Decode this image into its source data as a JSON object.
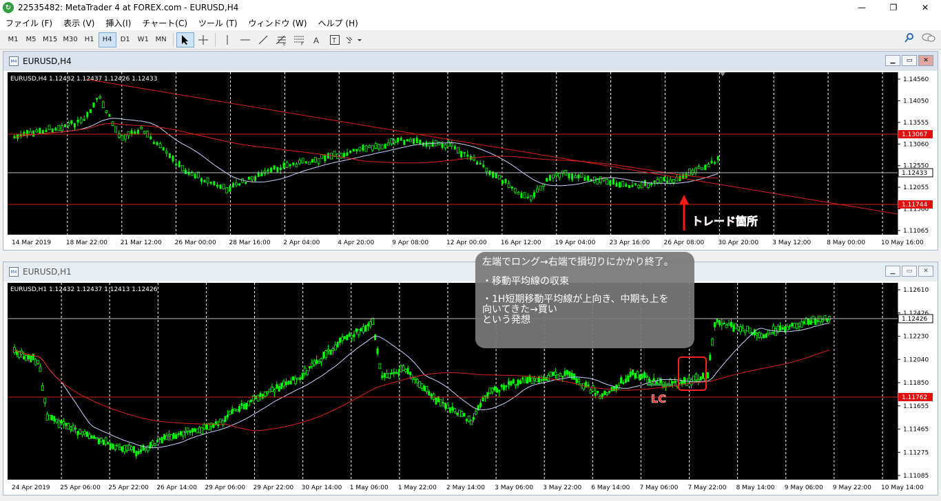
{
  "window": {
    "title": "22535482: MetaTrader 4 at FOREX.com - EURUSD,H4",
    "app_icon": "metatrader-icon",
    "buttons": {
      "min": "—",
      "max": "❐",
      "close": "✕"
    }
  },
  "menu": [
    "ファイル (F)",
    "表示 (V)",
    "挿入(I)",
    "チャート(C)",
    "ツール (T)",
    "ウィンドウ (W)",
    "ヘルプ (H)"
  ],
  "timeframes": [
    "M1",
    "M5",
    "M15",
    "M30",
    "H1",
    "H4",
    "D1",
    "W1",
    "MN"
  ],
  "active_timeframe": "H4",
  "tools": [
    "cursor-icon",
    "crosshair-icon",
    "vertical-line-icon",
    "horizontal-line-icon",
    "trendline-icon",
    "fibonacci-icon",
    "channel-icon",
    "text-icon",
    "text-label-icon",
    "arrows-icon"
  ],
  "chart1": {
    "window_title": "EURUSD,H4",
    "info": "EURUSD,H4  1.12432 1.12437 1.12426 1.12433",
    "price_ticks": [
      "1.14560",
      "1.14050",
      "1.13555",
      "1.13060",
      "1.12550",
      "1.12055",
      "1.11560",
      "1.11065"
    ],
    "hline_labels": [
      "1.13067",
      "1.12433",
      "1.11744"
    ],
    "time_ticks": [
      "14 Mar 2019",
      "18 Mar 22:00",
      "21 Mar 12:00",
      "26 Mar 00:00",
      "28 Mar 16:00",
      "2 Apr 04:00",
      "4 Apr 20:00",
      "9 Apr 08:00",
      "12 Apr 00:00",
      "16 Apr 12:00",
      "19 Apr 04:00",
      "23 Apr 16:00",
      "26 Apr 08:00",
      "30 Apr 20:00",
      "3 May 12:00",
      "8 May 00:00",
      "10 May 16:00"
    ],
    "annotation": "トレード箇所"
  },
  "chart2": {
    "window_title": "EURUSD,H1",
    "info": "EURUSD,H1  1.12432 1.12437 1.12413 1.12426",
    "price_ticks": [
      "1.12610",
      "1.12426",
      "1.12230",
      "1.12040",
      "1.11850",
      "1.11655",
      "1.11465",
      "1.11275",
      "1.11085"
    ],
    "hline_labels": [
      "1.12426",
      "1.11762"
    ],
    "time_ticks": [
      "24 Apr 2019",
      "25 Apr 06:00",
      "25 Apr 22:00",
      "26 Apr 14:00",
      "29 Apr 06:00",
      "29 Apr 22:00",
      "30 Apr 14:00",
      "1 May 06:00",
      "1 May 22:00",
      "2 May 14:00",
      "3 May 06:00",
      "3 May 22:00",
      "6 May 14:00",
      "7 May 06:00",
      "7 May 22:00",
      "8 May 14:00",
      "9 May 06:00",
      "9 May 22:00",
      "10 May 14:00"
    ],
    "lc_label": "LC"
  },
  "tooltip": {
    "line1": "左端でロング→右端で損切りにかかり終了。",
    "line2": "・移動平均線の収束",
    "line3": "・1H短期移動平均線が上向き、中期も上を\n向いてきた→買い\nという発想"
  }
}
